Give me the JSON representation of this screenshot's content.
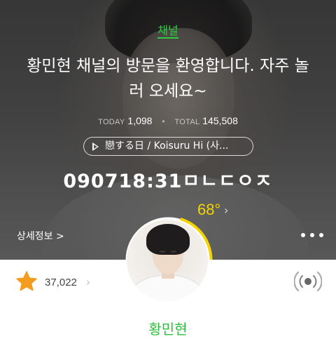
{
  "header": {
    "channel_label": "채널",
    "welcome_message": "황민현 채널의 방문을 환영합니다. 자주 놀러 오세요~"
  },
  "stats": {
    "today_label": "TODAY",
    "today_value": "1,098",
    "total_label": "TOTAL",
    "total_value": "145,508"
  },
  "music": {
    "icon": "play-icon",
    "track_title": "戀する日 / Koisuru Hi (사..."
  },
  "status_message": "090718:31ㅁㄴㄷㅇㅈ",
  "temperature": {
    "value": "68°",
    "progress_fraction": 0.28,
    "ring_color": "#f5d400"
  },
  "detail_link": "상세정보 >",
  "more_icon": "more-dots-icon",
  "favorites": {
    "icon": "star-icon",
    "count": "37,022",
    "chevron": "›"
  },
  "radio_icon": "broadcast-icon",
  "profile": {
    "name": "황민현"
  },
  "colors": {
    "accent_green": "#2ecc40",
    "temperature_yellow": "#f5d400",
    "star_orange": "#f39c1f"
  }
}
